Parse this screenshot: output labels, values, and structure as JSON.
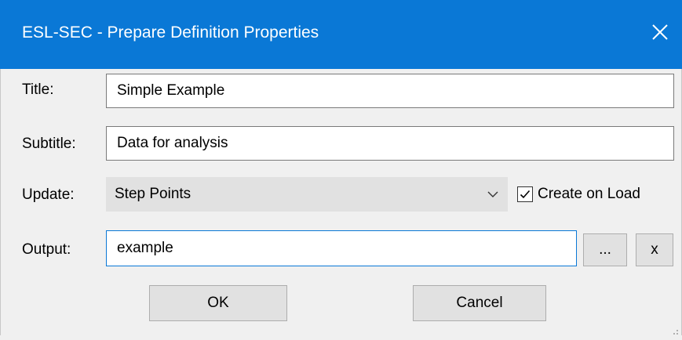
{
  "window": {
    "title": "ESL-SEC - Prepare Definition Properties",
    "close_icon": "close-icon",
    "accent_color": "#0a78d6"
  },
  "form": {
    "title_label": "Title:",
    "title_value": "Simple Example",
    "subtitle_label": "Subtitle:",
    "subtitle_value": "Data for analysis",
    "update_label": "Update:",
    "update_selected": "Step Points",
    "create_on_load_label": "Create on Load",
    "create_on_load_checked": true,
    "output_label": "Output:",
    "output_value": "example",
    "browse_label": "...",
    "clear_label": "x"
  },
  "buttons": {
    "ok_label": "OK",
    "cancel_label": "Cancel"
  }
}
